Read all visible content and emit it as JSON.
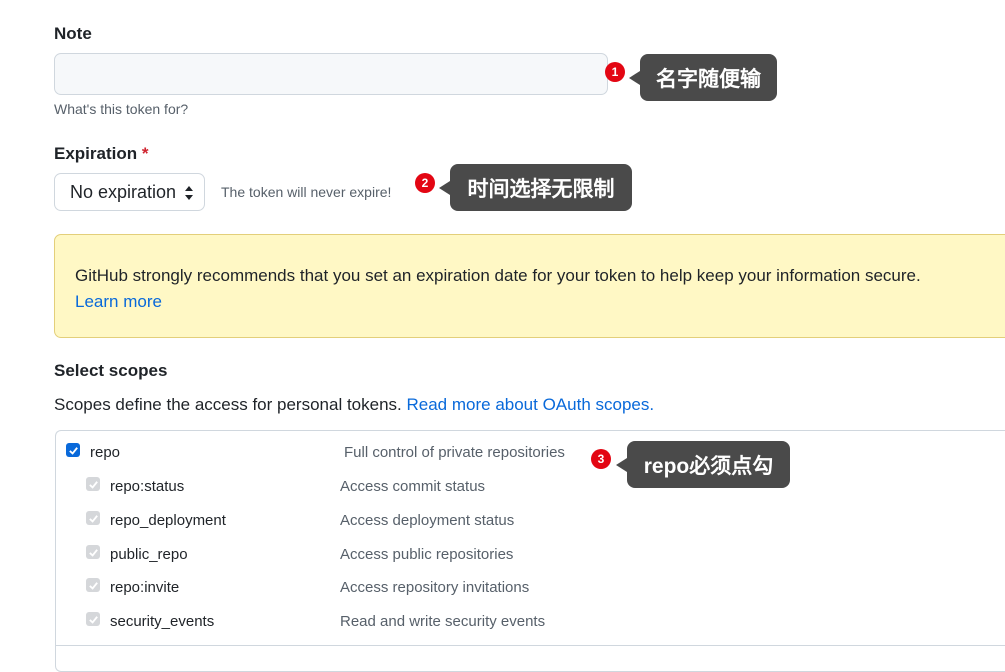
{
  "note": {
    "label": "Note",
    "value": "",
    "hint": "What's this token for?"
  },
  "expiration": {
    "label": "Expiration",
    "required_mark": "*",
    "selected": "No expiration",
    "hint": "The token will never expire!"
  },
  "flash": {
    "message": "GitHub strongly recommends that you set an expiration date for your token to help keep your information secure.",
    "link": "Learn more"
  },
  "scopes": {
    "title": "Select scopes",
    "description": "Scopes define the access for personal tokens.",
    "link": "Read more about OAuth scopes.",
    "items": [
      {
        "name": "repo",
        "desc": "Full control of private repositories",
        "checked": true,
        "disabled": false
      },
      {
        "name": "repo:status",
        "desc": "Access commit status",
        "checked": true,
        "disabled": true
      },
      {
        "name": "repo_deployment",
        "desc": "Access deployment status",
        "checked": true,
        "disabled": true
      },
      {
        "name": "public_repo",
        "desc": "Access public repositories",
        "checked": true,
        "disabled": true
      },
      {
        "name": "repo:invite",
        "desc": "Access repository invitations",
        "checked": true,
        "disabled": true
      },
      {
        "name": "security_events",
        "desc": "Read and write security events",
        "checked": true,
        "disabled": true
      }
    ]
  },
  "annotations": [
    {
      "number": "1",
      "text": "名字随便输"
    },
    {
      "number": "2",
      "text": "时间选择无限制"
    },
    {
      "number": "3",
      "text": "repo必须点勾"
    }
  ],
  "colors": {
    "accent": "#0969da",
    "badge": "#e30613",
    "callout": "#4a4a4a",
    "flash_bg": "#fff8c5"
  }
}
